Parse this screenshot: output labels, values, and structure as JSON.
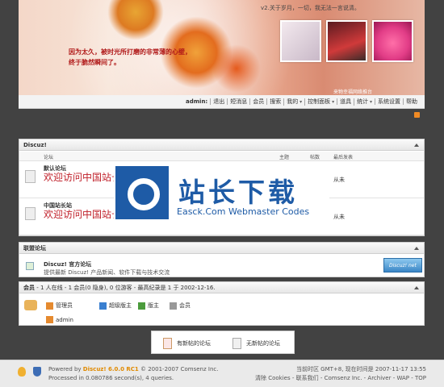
{
  "banner": {
    "poem": "v2.关于岁月，一切，我无法一言说清。",
    "slogan1": "因为太久，被时光所打磨的非常薄的心壁，",
    "slogan2": "终于脆然瞬间了。",
    "site": "来物幸福网络推台"
  },
  "usernav": {
    "user": "admin:",
    "items": [
      "退出",
      "短消息",
      "会员",
      "搜索",
      "我的",
      "控制面板",
      "道具",
      "统计",
      "系统设置",
      "帮助"
    ]
  },
  "forums": {
    "title": "Discuz!",
    "columns": {
      "forum": "论坛",
      "topics": "主题",
      "posts": "帖数",
      "last": "最后发表"
    },
    "rows": [
      {
        "name": "默认论坛",
        "desc": "欢迎访问中国站长下载站(SC.CHINAZ.COM)，提供更多更专业的素材下载。",
        "last": "从未"
      },
      {
        "name": "中国站长站",
        "desc": "欢迎访问中国站长下载站(SC.CHINAZ.COM)，提供更多更专业的素材下载。",
        "last": "从未"
      }
    ]
  },
  "watermark": {
    "big": "站长下载",
    "small": "Easck.Com Webmaster Codes"
  },
  "union": {
    "title": "联盟论坛",
    "name": "Discuz! 官方论坛",
    "desc": "提供最新 Discuz! 产品新闻、软件下载与技术交流",
    "logo_text": "Discuz! net"
  },
  "online": {
    "label": "会员",
    "stats": " - 1 人在线 - 1 会员(0 隐身), 0 位游客 - 最高纪录是 1 于 2002-12-16.",
    "groups": [
      "管理员",
      "超级版主",
      "版主",
      "会员"
    ],
    "colors": [
      "#e58a2f",
      "#3a7fd0",
      "#4b9b3c",
      "#999999"
    ],
    "users": [
      "admin"
    ]
  },
  "legend": {
    "new": "有新帖的论坛",
    "nonew": "无新帖的论坛"
  },
  "footer": {
    "powered_prefix": "Powered by ",
    "product": "Discuz! 6.0.0 RC1",
    "copyright": " © 2001-2007 Comsenz Inc.",
    "processed": "Processed in 0.080786 second(s), 4 queries.",
    "time": "当前时区 GMT+8, 现在时间是 2007-11-17 13:55",
    "links": "清除 Cookies - 联系我们 - Comsenz Inc. - Archiver - WAP - TOP"
  }
}
